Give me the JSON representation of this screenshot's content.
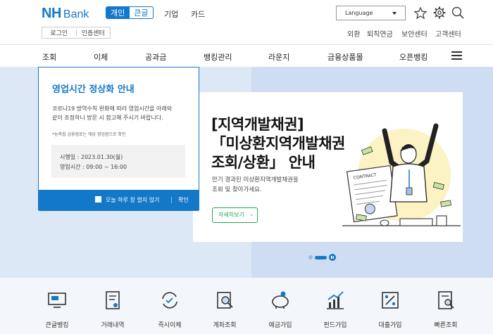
{
  "header": {
    "logo_nh": "NH",
    "logo_bank": "Bank",
    "tabs": [
      "개인",
      "큰글"
    ],
    "top_links": [
      "기업",
      "카드"
    ],
    "auth": [
      "로그인",
      "인증센터"
    ],
    "language": "Language",
    "util_links": [
      "외환",
      "퇴직연금",
      "보안센터",
      "고객센터"
    ]
  },
  "gnb": [
    "조회",
    "이체",
    "공과금",
    "뱅킹관리",
    "라운지",
    "금융상품몰",
    "오픈뱅킹"
  ],
  "popup": {
    "title": "영업시간 정상화 안내",
    "body1": "코로나19 방역수칙 완화에 따라 영업시간을 아래와",
    "body2": "같이 조정하니 방문 시 참고해 주시기 바랍니다.",
    "note": "*농축협 금융점포는 해당 영업점으로 확인",
    "date": "시행일 : 2023.01.30(월)",
    "hours": "영업시간 : 09:00 ~ 16:00",
    "dont_show": "오늘 하루 창 열지 않기",
    "confirm": "확인"
  },
  "banner": {
    "line1": "[지역개발채권]",
    "line2": "「미상환지역개발채권",
    "line3": "조회/상환」 안내",
    "sub1": "만기 경과된 미상환지역개발채권을",
    "sub2": "조회 및 찾아가세요.",
    "button": "자세히보기",
    "contract_label": "CONTRACT"
  },
  "quick_menu": [
    "큰글뱅킹",
    "거래내역",
    "즉시이체",
    "계좌조회",
    "예금가입",
    "펀드가입",
    "대출가입",
    "빠른조회"
  ],
  "colors": {
    "brand": "#1478c9",
    "green": "#2aa84a",
    "hero_bg": "#dde8f6"
  }
}
